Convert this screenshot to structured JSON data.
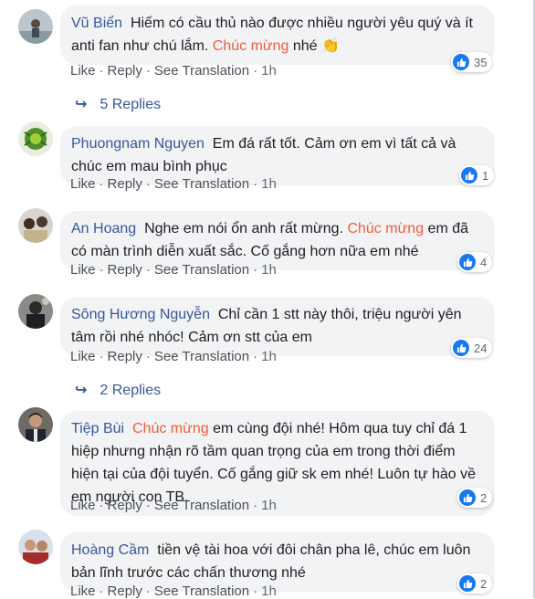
{
  "actions": {
    "like": "Like",
    "reply": "Reply",
    "translate": "See Translation",
    "sep": "·"
  },
  "comments": [
    {
      "author": "Vũ Biển",
      "parts": [
        "Hiếm có cầu thủ nào được nhiều người yêu quý và ít anti fan như chú lắm. ",
        "Chúc mừng",
        " nhé 👏"
      ],
      "time": "1h",
      "likes": "35"
    },
    {
      "author": "Phuongnam Nguyen",
      "parts": [
        "Em đá rất tốt. Cảm ơn em vì tất cả và chúc em mau bình phục"
      ],
      "time": "1h",
      "likes": "1"
    },
    {
      "author": "An Hoang",
      "parts": [
        "Nghe em nói ổn anh rất mừng. ",
        "Chúc mừng",
        " em đã có màn trình diễn xuất sắc. Cố gắng hơn nữa em nhé"
      ],
      "time": "1h",
      "likes": "4"
    },
    {
      "author": "Sông Hương Nguyễn",
      "parts": [
        "Chỉ cần 1 stt này thôi, triệu người yên tâm rồi nhé nhóc! Cảm ơn stt của em"
      ],
      "time": "1h",
      "likes": "24"
    },
    {
      "author": "Tiệp Bùi",
      "parts": [
        "",
        "Chúc mừng",
        " em cùng đội nhé! Hôm qua tuy chỉ đá 1 hiệp nhưng nhận rõ tầm quan trọng của em trong thời điểm hiện tại của đội tuyển. Cố gắng giữ sk em nhé! Luôn tự hào về em người con TB."
      ],
      "time": "1h",
      "likes": "2"
    },
    {
      "author": "Hoàng Cầm",
      "parts": [
        "tiền vệ tài hoa với đôi chân pha lê, chúc em luôn bản lĩnh trước các chấn thương nhé"
      ],
      "time": "1h",
      "likes": "2"
    }
  ],
  "replies": [
    {
      "label": "5 Replies",
      "arrow": "↪"
    },
    {
      "label": "2 Replies",
      "arrow": "↪"
    }
  ],
  "colors": {
    "author": "#385898",
    "highlight": "#f25c3b",
    "bubble": "#f2f3f5",
    "like": "#1877f2"
  },
  "icons": {
    "like_reaction": "thumbs-up-icon",
    "reply_arrow": "reply-arrow-icon"
  }
}
